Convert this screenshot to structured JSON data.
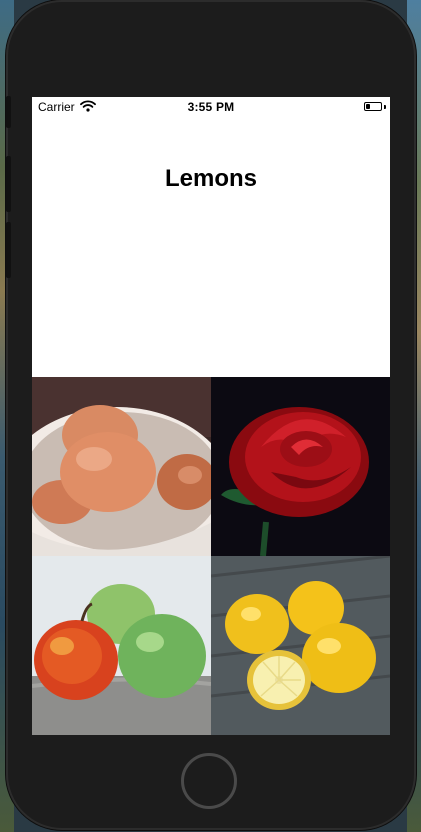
{
  "status_bar": {
    "carrier": "Carrier",
    "time": "3:55 PM",
    "wifi_icon": "wifi-icon",
    "battery_icon": "battery-icon",
    "battery_level": 0.3
  },
  "page": {
    "title": "Lemons"
  },
  "photos": [
    {
      "subject": "eggs"
    },
    {
      "subject": "rose"
    },
    {
      "subject": "apples"
    },
    {
      "subject": "lemons"
    }
  ],
  "colors": {
    "device_frame": "#1c1c1c",
    "screen_background": "#ffffff",
    "title_text": "#000000"
  }
}
